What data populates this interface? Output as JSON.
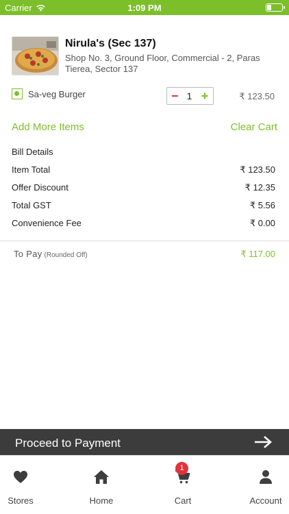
{
  "status_bar": {
    "carrier": "Carrier",
    "time": "1:09 PM",
    "battery_level": 0.3
  },
  "restaurant": {
    "name": "Nirula's (Sec 137)",
    "address": "Shop No. 3, Ground Floor, Commercial - 2, Paras Tierea, Sector 137"
  },
  "cart_item": {
    "name": "Sa-veg Burger",
    "quantity": "1",
    "price": "₹ 123.50",
    "minus_symbol": "−",
    "plus_symbol": "+"
  },
  "actions": {
    "add_more": "Add More Items",
    "clear_cart": "Clear Cart"
  },
  "bill": {
    "title": "Bill Details",
    "rows": [
      {
        "label": "Item Total",
        "value": "₹ 123.50"
      },
      {
        "label": "Offer Discount",
        "value": "₹ 12.35"
      },
      {
        "label": "Total GST",
        "value": "₹ 5.56"
      },
      {
        "label": "Convenience Fee",
        "value": "₹ 0.00"
      }
    ],
    "to_pay_label": "To Pay",
    "to_pay_note": "(Rounded Off)",
    "to_pay_value": "₹ 117.00"
  },
  "proceed": {
    "label": "Proceed to Payment",
    "icon": "arrow-right-icon"
  },
  "tabs": [
    {
      "label": "Stores",
      "icon": "heart-icon"
    },
    {
      "label": "Home",
      "icon": "home-icon"
    },
    {
      "label": "Cart",
      "icon": "cart-icon",
      "badge": "1"
    },
    {
      "label": "Account",
      "icon": "user-icon"
    }
  ],
  "colors": {
    "accent": "#7cbf2a",
    "minus": "#e0302a",
    "badge": "#e2323a",
    "proceed_bg": "#3c3c3c"
  }
}
